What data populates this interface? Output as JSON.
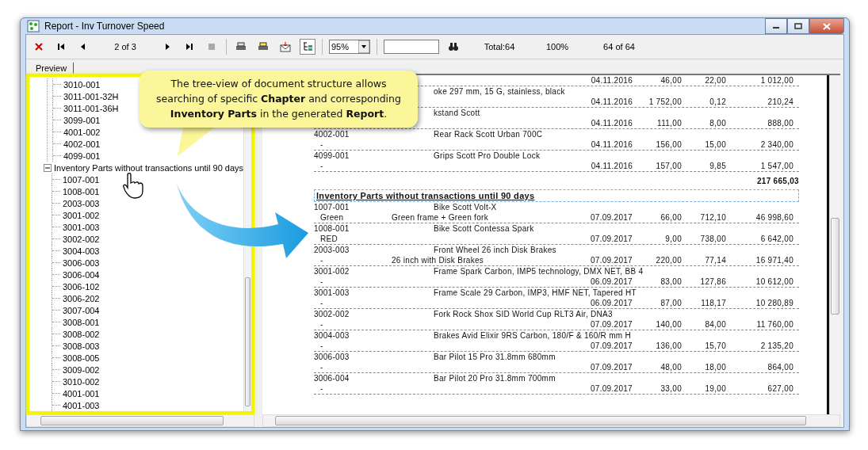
{
  "window": {
    "title": "Report - Inv Turnover Speed"
  },
  "toolbar": {
    "page": "2 of 3",
    "zoom": "95%",
    "total": "Total:64",
    "percent": "100%",
    "count": "64 of 64",
    "tree_toggle_on": true
  },
  "tabs": [
    {
      "label": "Preview",
      "selected": true
    }
  ],
  "tree": {
    "items": [
      {
        "children": [
          "3010-001",
          "3011-001-32H",
          "3011-001-36H",
          "3099-001",
          "4001-002",
          "4002-001",
          "4099-001"
        ]
      },
      {
        "label": "Inventory Parts without transactions until 90 days",
        "expanded": true,
        "children": [
          "1007-001",
          "1008-001",
          "2003-003",
          "3001-002",
          "3001-003",
          "3002-002",
          "3004-003",
          "3006-003",
          "3006-004",
          "3006-102",
          "3006-202",
          "3007-004",
          "3008-001",
          "3008-002",
          "3008-003",
          "3008-005",
          "3009-002",
          "3010-002",
          "4001-001",
          "4001-003"
        ]
      }
    ]
  },
  "report": {
    "rows_top": [
      {
        "date": "04.11.2016",
        "qty": "46,00",
        "price": "22,00",
        "total": "1 012,00"
      },
      {
        "description": "oke 297 mm, 15 G, stainless, black",
        "date": "04.11.2016",
        "qty": "1 752,00",
        "price": "0,12",
        "total": "210,24"
      },
      {
        "description": "kstand Scott",
        "date": "04.11.2016",
        "qty": "111,00",
        "price": "8,00",
        "total": "888,00"
      },
      {
        "code": "4002-001",
        "description": "Rear Rack Scott Urban 700C",
        "variant": "-",
        "date": "04.11.2016",
        "qty": "156,00",
        "price": "15,00",
        "total": "2 340,00"
      },
      {
        "code": "4099-001",
        "description": "Grips Scott Pro Double Lock",
        "variant": "-",
        "date": "04.11.2016",
        "qty": "157,00",
        "price": "9,85",
        "total": "1 547,00"
      }
    ],
    "sum": "217 665,03",
    "section_title": "Inventory Parts without transactions until 90 days",
    "rows": [
      {
        "code": "1007-001",
        "description": "Bike Scott Volt-X",
        "variant": "Green",
        "note": "Green frame + Green fork",
        "date": "07.09.2017",
        "qty": "66,00",
        "price": "712,10",
        "total": "46 998,60"
      },
      {
        "code": "1008-001",
        "description": "Bike Scott Contessa Spark",
        "variant": "RED",
        "date": "07.09.2017",
        "qty": "9,00",
        "price": "738,00",
        "total": "6 642,00"
      },
      {
        "code": "2003-003",
        "description": "Front Wheel 26 inch Disk Brakes",
        "variant": "-",
        "note": "26 inch with Disk Brakes",
        "date": "07.09.2017",
        "qty": "220,00",
        "price": "77,14",
        "total": "16 971,40"
      },
      {
        "code": "3001-002",
        "description": "Frame Spark Carbon, IMP5 technology, DMX NET, BB 4",
        "variant": "-",
        "date": "06.09.2017",
        "qty": "83,00",
        "price": "127,86",
        "total": "10 612,00"
      },
      {
        "code": "3001-003",
        "description": "Frame Scale 29 Carbon, IMP3, HMF NET, Tapered HT",
        "variant": "-",
        "date": "06.09.2017",
        "qty": "87,00",
        "price": "118,17",
        "total": "10 280,89"
      },
      {
        "code": "3002-002",
        "description": "Fork Rock Shox SID World Cup RLT3 Air, DNA3",
        "variant": "-",
        "date": "07.09.2017",
        "qty": "140,00",
        "price": "84,00",
        "total": "11 760,00"
      },
      {
        "code": "3004-003",
        "description": "Brakes Avid Elixir 9RS Carbon, 180/F & 160/R mm H",
        "variant": "-",
        "date": "07.09.2017",
        "qty": "136,00",
        "price": "15,70",
        "total": "2 135,20"
      },
      {
        "code": "3006-003",
        "description": "Bar Pilot 15 Pro 31.8mm 680mm",
        "variant": "-",
        "date": "07.09.2017",
        "qty": "48,00",
        "price": "18,00",
        "total": "864,00"
      },
      {
        "code": "3006-004",
        "description": "Bar Pilot 20 Pro 31.8mm 700mm",
        "variant": "-",
        "date": "07.09.2017",
        "qty": "33,00",
        "price": "19,00",
        "total": "627,00"
      }
    ]
  },
  "callout": {
    "text": "The tree-view of document structure allows searching of specific **Chapter** and corresponding **Inventory Parts** in the generated **Report**."
  }
}
